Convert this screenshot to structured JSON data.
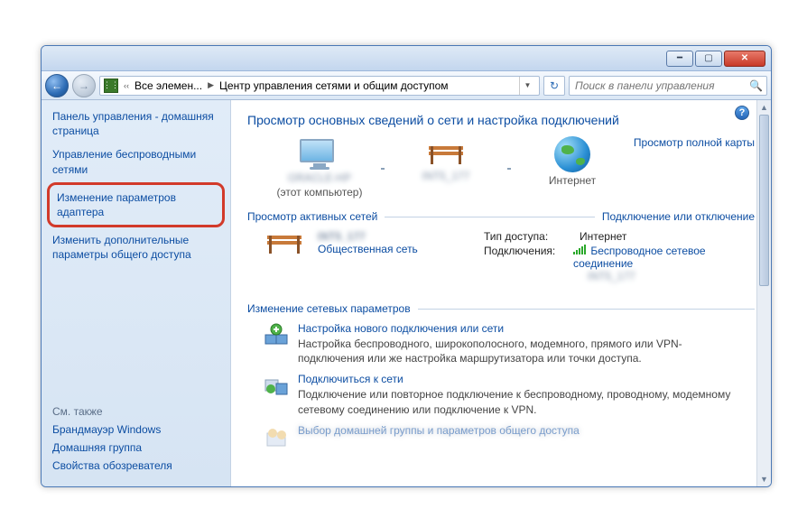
{
  "breadcrumb": {
    "part1": "Все элемен...",
    "part2": "Центр управления сетями и общим доступом"
  },
  "search": {
    "placeholder": "Поиск в панели управления"
  },
  "sidebar": {
    "home": "Панель управления - домашняя страница",
    "wireless": "Управление беспроводными сетями",
    "adapter": "Изменение параметров адаптера",
    "sharing": "Изменить дополнительные параметры общего доступа"
  },
  "seealso": {
    "header": "См. также",
    "firewall": "Брандмауэр Windows",
    "homegroup": "Домашняя группа",
    "internet_options": "Свойства обозревателя"
  },
  "main": {
    "title": "Просмотр основных сведений о сети и настройка подключений",
    "full_map": "Просмотр полной карты",
    "this_computer": "(этот компьютер)",
    "computer_name": "ORACLE-HP",
    "network_name": "INT5_177",
    "internet": "Интернет",
    "active_head": "Просмотр активных сетей",
    "connect_disconnect": "Подключение или отключение",
    "net_label": "INT5_177",
    "public_network": "Общественная сеть",
    "access_type_k": "Тип доступа:",
    "access_type_v": "Интернет",
    "connections_k": "Подключения:",
    "connection_link": "Беспроводное сетевое соединение",
    "connection_sub": "INT5_177",
    "change_head": "Изменение сетевых параметров",
    "task1_name": "Настройка нового подключения или сети",
    "task1_desc": "Настройка беспроводного, широкополосного, модемного, прямого или VPN-подключения или же настройка маршрутизатора или точки доступа.",
    "task2_name": "Подключиться к сети",
    "task2_desc": "Подключение или повторное подключение к беспроводному, проводному, модемному сетевому соединению или подключение к VPN.",
    "task3_name": "Выбор домашней группы и параметров общего доступа"
  }
}
